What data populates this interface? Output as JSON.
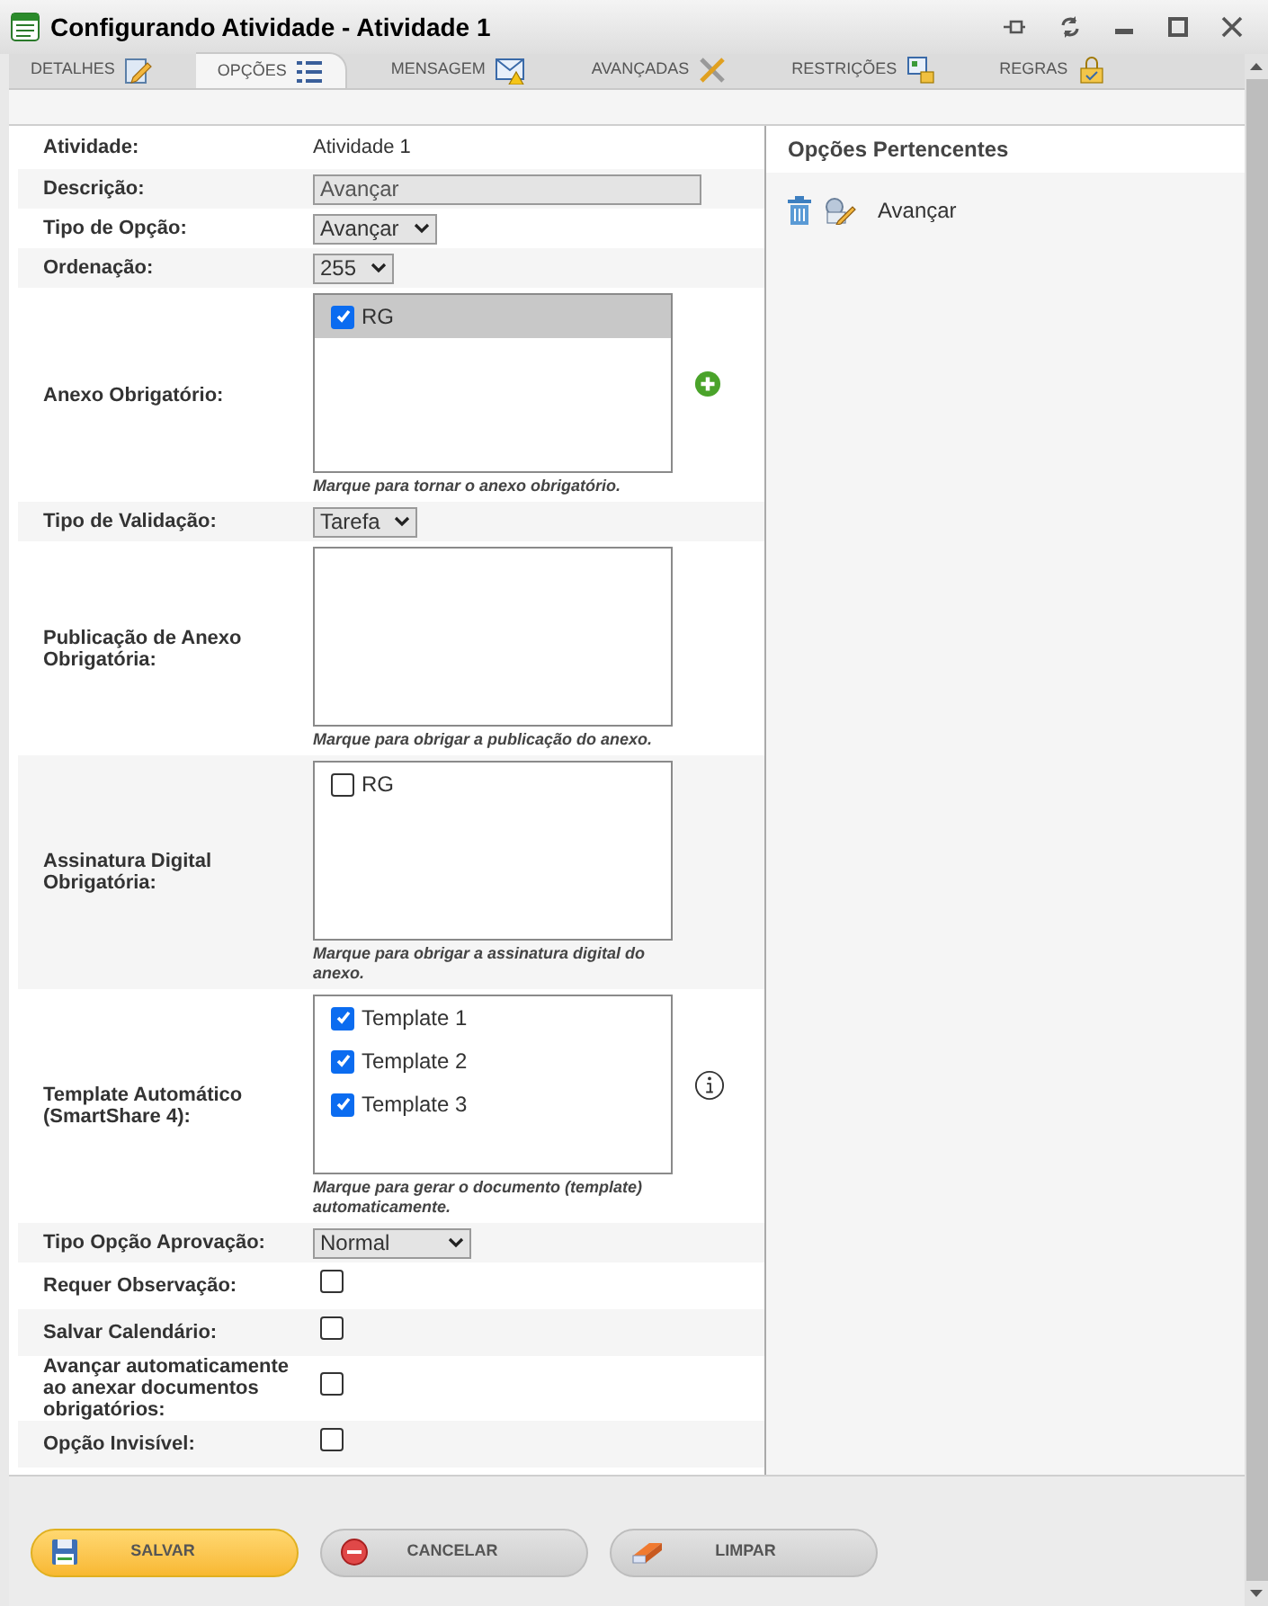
{
  "window": {
    "title": "Configurando Atividade - Atividade 1"
  },
  "tabs": [
    {
      "label": "DETALHES",
      "selected": false
    },
    {
      "label": "OPÇÕES",
      "selected": true
    },
    {
      "label": "MENSAGEM",
      "selected": false
    },
    {
      "label": "AVANÇADAS",
      "selected": false
    },
    {
      "label": "RESTRIÇÕES",
      "selected": false
    },
    {
      "label": "REGRAS",
      "selected": false
    }
  ],
  "activity": {
    "label": "Atividade:",
    "value": "Atividade 1"
  },
  "fields": [
    {
      "kind": "text",
      "label": "Descrição:",
      "value": "Avançar"
    },
    {
      "kind": "select",
      "label": "Tipo de Opção:",
      "value": "Avançar"
    },
    {
      "kind": "select",
      "label": "Ordenação:",
      "value": "255"
    },
    {
      "kind": "checklist",
      "label": "Anexo Obrigatório:",
      "hint": "Marque para tornar o anexo obrigatório.",
      "items": [
        {
          "label": "RG",
          "checked": true,
          "selected": true
        }
      ]
    },
    {
      "kind": "select",
      "label": "Tipo de Validação:",
      "value": "Tarefa"
    },
    {
      "kind": "checklist",
      "label": "Publicação de Anexo Obrigatória:",
      "hint": "Marque para obrigar a publicação do anexo."
    },
    {
      "kind": "checklist",
      "label": "Assinatura Digital Obrigatória:",
      "hint": "Marque para obrigar a assinatura digital do anexo.",
      "items": [
        {
          "label": "RG",
          "checked": false,
          "selected": false
        }
      ]
    },
    {
      "kind": "checklist",
      "label": "Template Automático (SmartShare 4):",
      "hint": "Marque para gerar o documento (template) automaticamente.",
      "items": [
        {
          "label": "Template 1",
          "checked": true,
          "selected": false
        },
        {
          "label": "Template 2",
          "checked": true,
          "selected": false
        },
        {
          "label": "Template 3",
          "checked": true,
          "selected": false
        }
      ]
    },
    {
      "kind": "select",
      "label": "Tipo Opção Aprovação:",
      "value": "Normal"
    },
    {
      "kind": "checkbox",
      "label": "Requer Observação:",
      "checked": false
    },
    {
      "kind": "checkbox",
      "label": "Salvar Calendário:",
      "checked": false
    },
    {
      "kind": "checkbox",
      "label": "Avançar automaticamente ao anexar documentos obrigatórios:",
      "checked": false
    },
    {
      "kind": "checkbox",
      "label": "Opção Invisível:",
      "checked": false
    }
  ],
  "panel": {
    "title": "Opções Pertencentes",
    "items": [
      {
        "label": "Avançar"
      }
    ]
  },
  "buttons": [
    {
      "label": "SALVAR",
      "kind": "save"
    },
    {
      "label": "CANCELAR",
      "kind": "cancel"
    },
    {
      "label": "LIMPAR",
      "kind": "clear"
    }
  ]
}
